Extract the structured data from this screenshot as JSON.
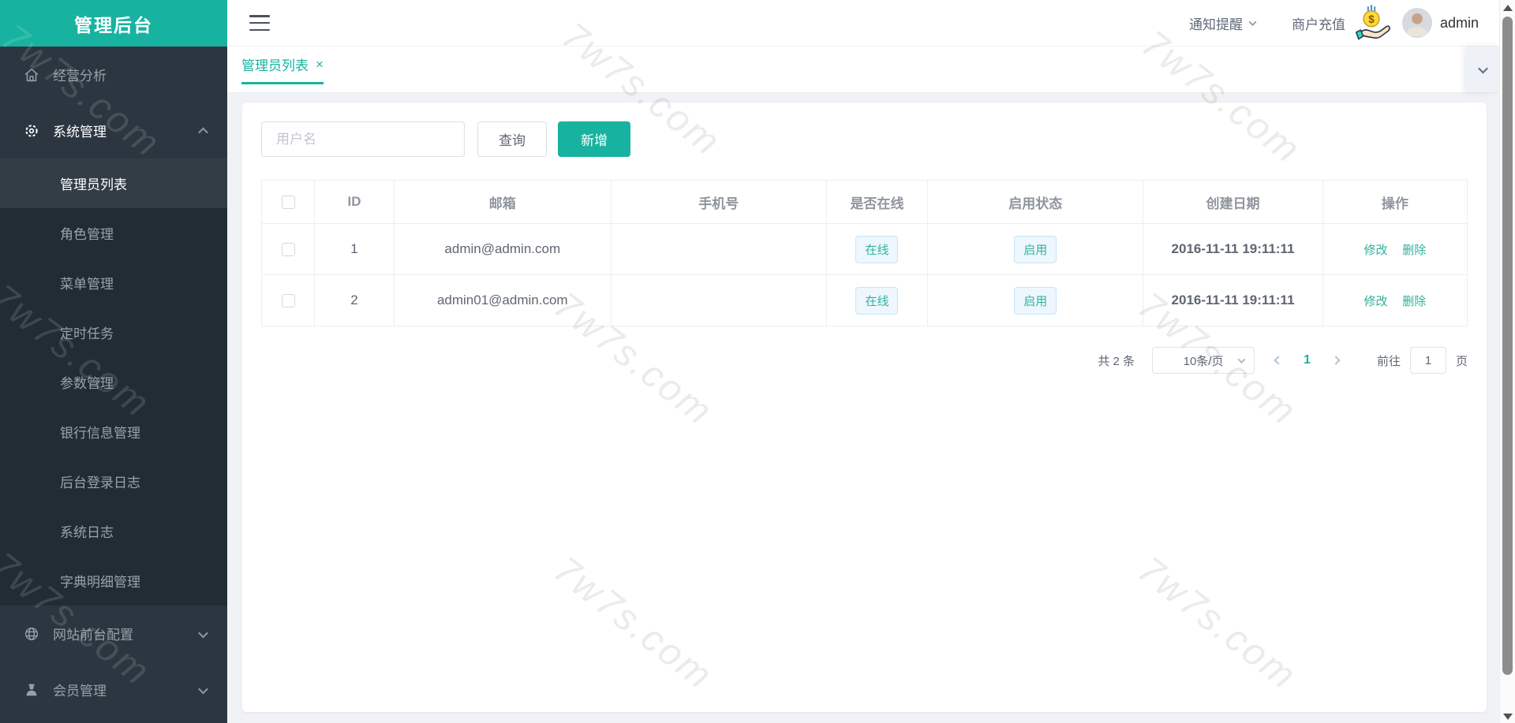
{
  "colors": {
    "accent": "#17b3a0",
    "sidebar_bg": "#2b3640",
    "submenu_bg": "#222c34",
    "tag_text": "#32b2a0"
  },
  "logo": {
    "title": "管理后台"
  },
  "sidebar": {
    "menu": [
      {
        "label": "经营分析",
        "icon": "home-icon"
      },
      {
        "label": "系统管理",
        "icon": "gear-icon",
        "state": "expanded",
        "children": [
          {
            "label": "管理员列表",
            "active": true
          },
          {
            "label": "角色管理"
          },
          {
            "label": "菜单管理"
          },
          {
            "label": "定时任务"
          },
          {
            "label": "参数管理"
          },
          {
            "label": "银行信息管理"
          },
          {
            "label": "后台登录日志"
          },
          {
            "label": "系统日志"
          },
          {
            "label": "字典明细管理"
          }
        ]
      },
      {
        "label": "网站前台配置",
        "icon": "globe-icon",
        "state": "collapsed"
      },
      {
        "label": "会员管理",
        "icon": "member-icon",
        "state": "collapsed"
      }
    ]
  },
  "navbar": {
    "notice_label": "通知提醒",
    "recharge_label": "商户充值",
    "username": "admin"
  },
  "tabbar": {
    "tabs": [
      {
        "label": "管理员列表",
        "close": "×",
        "active": true
      }
    ]
  },
  "filters": {
    "username_placeholder": "用户名",
    "query_label": "查询",
    "add_label": "新增"
  },
  "table": {
    "headers": [
      "ID",
      "邮箱",
      "手机号",
      "是否在线",
      "启用状态",
      "创建日期",
      "操作"
    ],
    "rows": [
      {
        "id": "1",
        "email": "admin@admin.com",
        "phone": "",
        "online": "在线",
        "enabled": "启用",
        "created": "2016-11-11 19:11:11",
        "edit": "修改",
        "delete": "删除"
      },
      {
        "id": "2",
        "email": "admin01@admin.com",
        "phone": "",
        "online": "在线",
        "enabled": "启用",
        "created": "2016-11-11 19:11:11",
        "edit": "修改",
        "delete": "删除"
      }
    ]
  },
  "pagination": {
    "total": "共 2 条",
    "page_size": "10条/页",
    "current_page": "1",
    "goto_label": "前往",
    "goto_value": "1",
    "unit_label": "页"
  },
  "watermark": {
    "text": "7w7s.com"
  }
}
